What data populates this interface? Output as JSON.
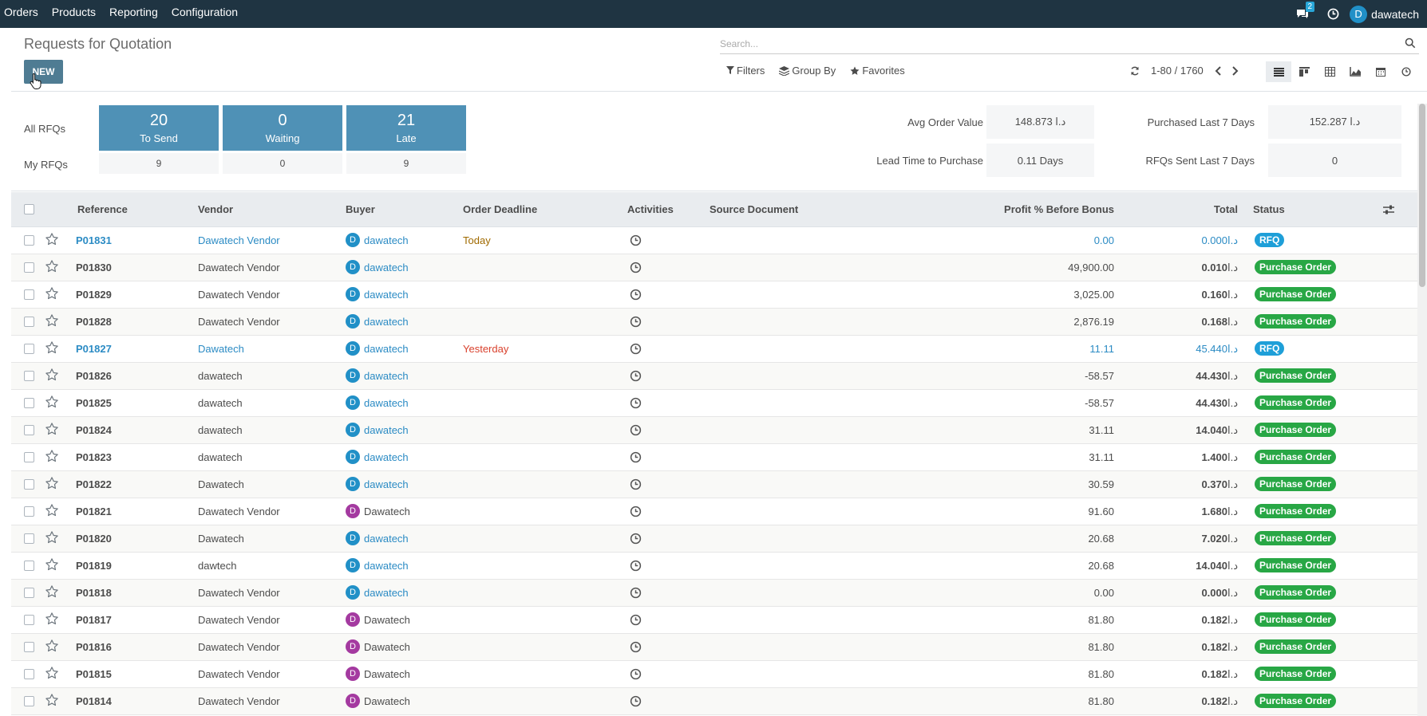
{
  "navbar": {
    "menu": [
      "Orders",
      "Products",
      "Reporting",
      "Configuration"
    ],
    "messages_count": "2",
    "user_initial": "D",
    "user_name": "dawatech"
  },
  "control_panel": {
    "title": "Requests for Quotation",
    "new_label": "NEW",
    "search_placeholder": "Search...",
    "filters_label": "Filters",
    "group_by_label": "Group By",
    "favorites_label": "Favorites",
    "pager": "1-80 / 1760"
  },
  "dashboard": {
    "all_rfqs_label": "All RFQs",
    "my_rfqs_label": "My RFQs",
    "tiles": [
      {
        "count": "20",
        "label": "To Send",
        "my": "9"
      },
      {
        "count": "0",
        "label": "Waiting",
        "my": "0"
      },
      {
        "count": "21",
        "label": "Late",
        "my": "9"
      }
    ],
    "kpis": [
      {
        "label": "Avg Order Value",
        "value": "148.873 د.ا"
      },
      {
        "label": "Lead Time to Purchase",
        "value": "0.11 Days"
      },
      {
        "label": "Purchased Last 7 Days",
        "value": "152.287 د.ا"
      },
      {
        "label": "RFQs Sent Last 7 Days",
        "value": "0"
      }
    ]
  },
  "table": {
    "headers": {
      "reference": "Reference",
      "vendor": "Vendor",
      "buyer": "Buyer",
      "deadline": "Order Deadline",
      "activities": "Activities",
      "source": "Source Document",
      "profit": "Profit % Before Bonus",
      "total": "Total",
      "status": "Status"
    },
    "currency": "د.ا",
    "rows": [
      {
        "ref": "P01831",
        "vendor": "Dawatech Vendor",
        "buyer_initial": "D",
        "buyer": "dawatech",
        "deadline": "Today",
        "profit": "0.00",
        "total": "0.000",
        "status": "RFQ"
      },
      {
        "ref": "P01830",
        "vendor": "Dawatech Vendor",
        "buyer_initial": "D",
        "buyer": "dawatech",
        "deadline": "",
        "profit": "49,900.00",
        "total": "0.010",
        "status": "Purchase Order"
      },
      {
        "ref": "P01829",
        "vendor": "Dawatech Vendor",
        "buyer_initial": "D",
        "buyer": "dawatech",
        "deadline": "",
        "profit": "3,025.00",
        "total": "0.160",
        "status": "Purchase Order"
      },
      {
        "ref": "P01828",
        "vendor": "Dawatech Vendor",
        "buyer_initial": "D",
        "buyer": "dawatech",
        "deadline": "",
        "profit": "2,876.19",
        "total": "0.168",
        "status": "Purchase Order"
      },
      {
        "ref": "P01827",
        "vendor": "Dawatech",
        "buyer_initial": "D",
        "buyer": "dawatech",
        "deadline": "Yesterday",
        "profit": "11.11",
        "total": "45.440",
        "status": "RFQ"
      },
      {
        "ref": "P01826",
        "vendor": "dawatech",
        "buyer_initial": "D",
        "buyer": "dawatech",
        "deadline": "",
        "profit": "-58.57",
        "total": "44.430",
        "status": "Purchase Order"
      },
      {
        "ref": "P01825",
        "vendor": "dawatech",
        "buyer_initial": "D",
        "buyer": "dawatech",
        "deadline": "",
        "profit": "-58.57",
        "total": "44.430",
        "status": "Purchase Order"
      },
      {
        "ref": "P01824",
        "vendor": "dawatech",
        "buyer_initial": "D",
        "buyer": "dawatech",
        "deadline": "",
        "profit": "31.11",
        "total": "14.040",
        "status": "Purchase Order"
      },
      {
        "ref": "P01823",
        "vendor": "dawatech",
        "buyer_initial": "D",
        "buyer": "dawatech",
        "deadline": "",
        "profit": "31.11",
        "total": "1.400",
        "status": "Purchase Order"
      },
      {
        "ref": "P01822",
        "vendor": "Dawatech",
        "buyer_initial": "D",
        "buyer": "dawatech",
        "deadline": "",
        "profit": "30.59",
        "total": "0.370",
        "status": "Purchase Order"
      },
      {
        "ref": "P01821",
        "vendor": "Dawatech Vendor",
        "buyer_initial": "D",
        "buyer": "Dawatech",
        "deadline": "",
        "profit": "91.60",
        "total": "1.680",
        "status": "Purchase Order"
      },
      {
        "ref": "P01820",
        "vendor": "Dawatech",
        "buyer_initial": "D",
        "buyer": "dawatech",
        "deadline": "",
        "profit": "20.68",
        "total": "7.020",
        "status": "Purchase Order"
      },
      {
        "ref": "P01819",
        "vendor": "dawtech",
        "buyer_initial": "D",
        "buyer": "dawatech",
        "deadline": "",
        "profit": "20.68",
        "total": "14.040",
        "status": "Purchase Order"
      },
      {
        "ref": "P01818",
        "vendor": "Dawatech Vendor",
        "buyer_initial": "D",
        "buyer": "dawatech",
        "deadline": "",
        "profit": "0.00",
        "total": "0.000",
        "status": "Purchase Order"
      },
      {
        "ref": "P01817",
        "vendor": "Dawatech Vendor",
        "buyer_initial": "D",
        "buyer": "Dawatech",
        "deadline": "",
        "profit": "81.80",
        "total": "0.182",
        "status": "Purchase Order"
      },
      {
        "ref": "P01816",
        "vendor": "Dawatech Vendor",
        "buyer_initial": "D",
        "buyer": "Dawatech",
        "deadline": "",
        "profit": "81.80",
        "total": "0.182",
        "status": "Purchase Order"
      },
      {
        "ref": "P01815",
        "vendor": "Dawatech Vendor",
        "buyer_initial": "D",
        "buyer": "Dawatech",
        "deadline": "",
        "profit": "81.80",
        "total": "0.182",
        "status": "Purchase Order"
      },
      {
        "ref": "P01814",
        "vendor": "Dawatech Vendor",
        "buyer_initial": "D",
        "buyer": "Dawatech",
        "deadline": "",
        "profit": "81.80",
        "total": "0.182",
        "status": "Purchase Order"
      }
    ]
  },
  "colors": {
    "navbar": "#1f3442",
    "tile": "#4f91b6",
    "purchase_order_badge": "#28a745",
    "rfq_badge": "#1e9fd8",
    "link": "#2b8bc4"
  },
  "icons": {
    "messages": "chat-icon",
    "activity": "clock-icon",
    "favorite": "star-icon",
    "refresh": "refresh-icon",
    "views": [
      "list-icon",
      "kanban-icon",
      "pivot-icon",
      "graph-icon",
      "calendar-icon",
      "activity-view-icon"
    ]
  }
}
